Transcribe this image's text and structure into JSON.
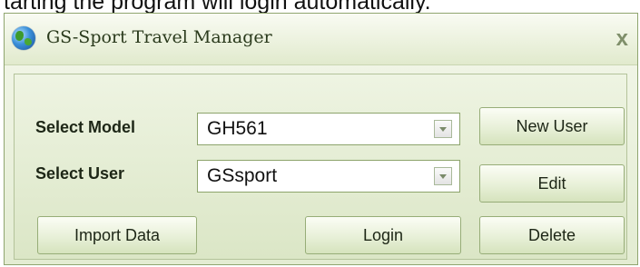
{
  "caption": "tarting the program will login automatically.",
  "window": {
    "title": "GS-Sport Travel Manager",
    "close_icon": "x"
  },
  "form": {
    "model_label": "Select Model",
    "model_value": "GH561",
    "user_label": "Select User",
    "user_value": "GSsport"
  },
  "buttons": {
    "new_user": "New User",
    "edit": "Edit",
    "delete": "Delete",
    "import_data": "Import Data",
    "login": "Login"
  },
  "icons": {
    "app_icon": "globe-icon",
    "close": "close-icon",
    "dropdown": "chevron-down-icon"
  }
}
